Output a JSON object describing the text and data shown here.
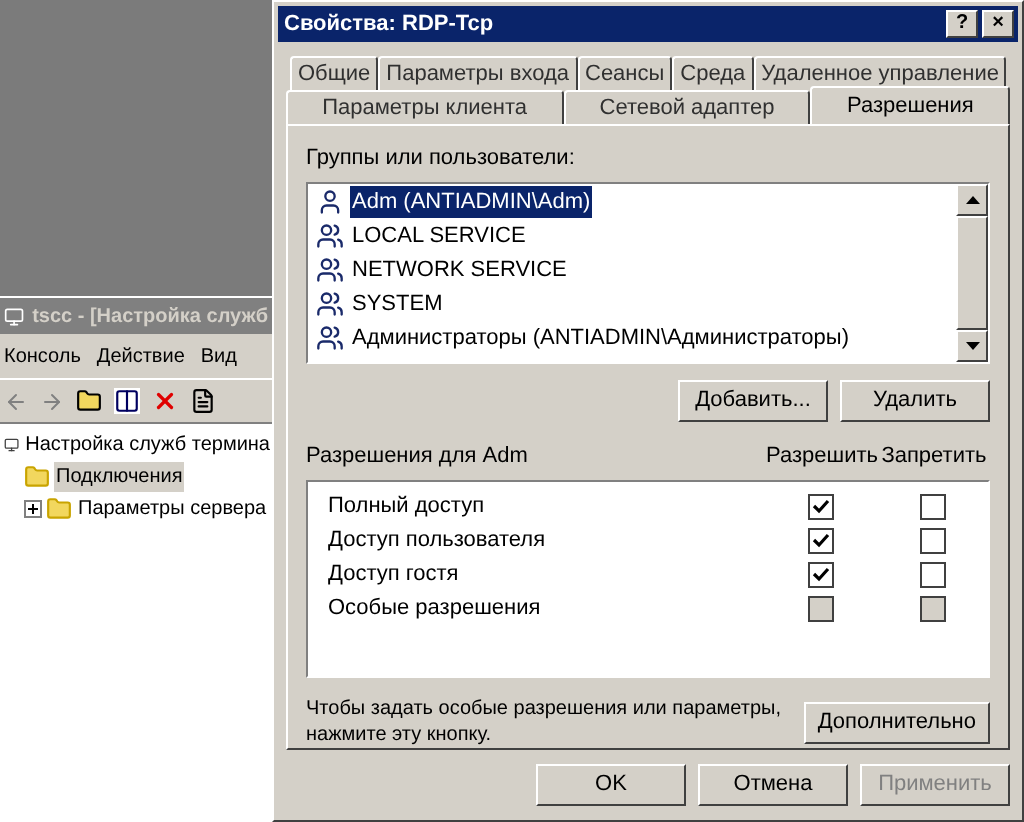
{
  "console": {
    "title": "tscc - [Настройка служб",
    "menu": [
      "Консоль",
      "Действие",
      "Вид"
    ],
    "tree": [
      {
        "label": "Настройка служб термина",
        "kind": "root",
        "selected": false,
        "children": [
          {
            "label": "Подключения",
            "kind": "folder",
            "selected": true
          },
          {
            "label": "Параметры сервера",
            "kind": "folder",
            "selected": false,
            "expanded": false
          }
        ]
      }
    ]
  },
  "window": {
    "title": "Свойства: RDP-Tcp",
    "title_buttons": [
      "?",
      "×"
    ]
  },
  "tab_rows": [
    [
      {
        "label": "Общие",
        "selected": false
      },
      {
        "label": "Параметры входа",
        "selected": false
      },
      {
        "label": "Сеансы",
        "selected": false
      },
      {
        "label": "Среда",
        "selected": false
      },
      {
        "label": "Удаленное управление",
        "selected": false
      }
    ],
    [
      {
        "label": "Параметры клиента",
        "selected": false
      },
      {
        "label": "Сетевой адаптер",
        "selected": false
      },
      {
        "label": "Разрешения",
        "selected": true
      }
    ]
  ],
  "users": {
    "label": "Группы или пользователи:",
    "items": [
      {
        "name": "Adm (ANTIADMIN\\Adm)",
        "kind": "user",
        "selected": true
      },
      {
        "name": "LOCAL SERVICE",
        "kind": "group",
        "selected": false
      },
      {
        "name": "NETWORK SERVICE",
        "kind": "group",
        "selected": false
      },
      {
        "name": "SYSTEM",
        "kind": "group",
        "selected": false
      },
      {
        "name": "Администраторы (ANTIADMIN\\Администраторы)",
        "kind": "group",
        "selected": false
      }
    ],
    "buttons": [
      "Добавить...",
      "Удалить"
    ]
  },
  "permissions": {
    "label": "Разрешения для Adm",
    "columns": [
      "Разрешить",
      "Запретить"
    ],
    "rows": [
      {
        "name": "Полный доступ",
        "allow": true,
        "deny": false,
        "disabled": false
      },
      {
        "name": "Доступ пользователя",
        "allow": true,
        "deny": false,
        "disabled": false
      },
      {
        "name": "Доступ гостя",
        "allow": true,
        "deny": false,
        "disabled": false
      },
      {
        "name": "Особые разрешения",
        "allow": false,
        "deny": false,
        "disabled": true
      }
    ]
  },
  "hint": "Чтобы задать особые разрешения или параметры, нажмите эту кнопку.",
  "advanced_button": "Дополнительно",
  "footer_buttons": [
    {
      "label": "OK",
      "disabled": false
    },
    {
      "label": "Отмена",
      "disabled": false
    },
    {
      "label": "Применить",
      "disabled": true
    }
  ]
}
